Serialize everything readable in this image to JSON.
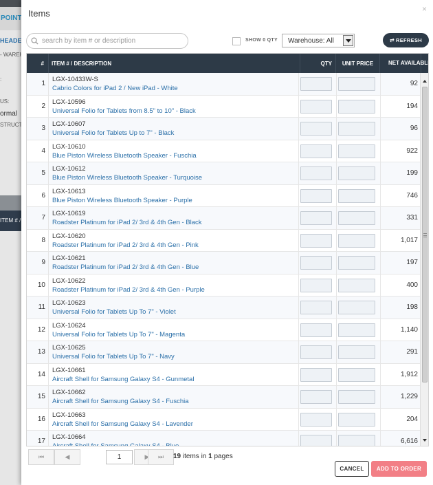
{
  "background": {
    "tab_label": "POINTS",
    "section_header": "HEADER",
    "warehouse_fragment": "- WAREH",
    "status_fragment": "US:",
    "normal_fragment": "ormal",
    "instructions_fragment": "STRUCTI",
    "item_header_fragment": "ITEM # /"
  },
  "modal": {
    "title": "Items",
    "close_label": "×",
    "search_placeholder": "search by item # or description",
    "search_value": "",
    "show_zero_label": "SHOW 0 QTY",
    "warehouse_label": "Warehouse: All",
    "refresh_label": "REFRESH",
    "cancel_label": "CANCEL",
    "add_label": "ADD TO ORDER"
  },
  "columns": {
    "num": "#",
    "item": "ITEM # / DESCRIPTION",
    "qty": "QTY",
    "price": "UNIT PRICE",
    "net": "NET AVAILABLE"
  },
  "rows": [
    {
      "n": "1",
      "sku": "LGX-10433W-S",
      "desc": "Cabrio Colors for iPad 2 / New iPad - White",
      "net": "92"
    },
    {
      "n": "2",
      "sku": "LGX-10596",
      "desc": "Universal Folio for Tablets from 8.5\" to 10\" - Black",
      "net": "194"
    },
    {
      "n": "3",
      "sku": "LGX-10607",
      "desc": "Universal Folio for Tablets Up to 7\" - Black",
      "net": "96"
    },
    {
      "n": "4",
      "sku": "LGX-10610",
      "desc": "Blue Piston Wireless Bluetooth Speaker - Fuschia",
      "net": "922"
    },
    {
      "n": "5",
      "sku": "LGX-10612",
      "desc": "Blue Piston Wireless Bluetooth Speaker - Turquoise",
      "net": "199"
    },
    {
      "n": "6",
      "sku": "LGX-10613",
      "desc": "Blue Piston Wireless Bluetooth Speaker - Purple",
      "net": "746"
    },
    {
      "n": "7",
      "sku": "LGX-10619",
      "desc": "Roadster Platinum for iPad 2/ 3rd & 4th Gen - Black",
      "net": "331"
    },
    {
      "n": "8",
      "sku": "LGX-10620",
      "desc": "Roadster Platinum for iPad 2/ 3rd & 4th Gen - Pink",
      "net": "1,017"
    },
    {
      "n": "9",
      "sku": "LGX-10621",
      "desc": "Roadster Platinum for iPad 2/ 3rd & 4th Gen - Blue",
      "net": "197"
    },
    {
      "n": "10",
      "sku": "LGX-10622",
      "desc": "Roadster Platinum for iPad 2/ 3rd & 4th Gen - Purple",
      "net": "400"
    },
    {
      "n": "11",
      "sku": "LGX-10623",
      "desc": "Universal Folio for Tablets Up To 7\" - Violet",
      "net": "198"
    },
    {
      "n": "12",
      "sku": "LGX-10624",
      "desc": "Universal Folio for Tablets Up To 7\" - Magenta",
      "net": "1,140"
    },
    {
      "n": "13",
      "sku": "LGX-10625",
      "desc": "Universal Folio for Tablets Up To 7\" - Navy",
      "net": "291"
    },
    {
      "n": "14",
      "sku": "LGX-10661",
      "desc": "Aircraft Shell for Samsung Galaxy S4 - Gunmetal",
      "net": "1,912"
    },
    {
      "n": "15",
      "sku": "LGX-10662",
      "desc": "Aircraft Shell for Samsung Galaxy S4 - Fuschia",
      "net": "1,229"
    },
    {
      "n": "16",
      "sku": "LGX-10663",
      "desc": "Aircraft Shell for Samsung Galaxy S4 - Lavender",
      "net": "204"
    },
    {
      "n": "17",
      "sku": "LGX-10664",
      "desc": "Aircraft Shell for Samsung Galaxy S4 - Blue",
      "net": "6,616"
    }
  ],
  "pager": {
    "first_icon": "first-page-icon",
    "prev_icon": "prev-page-icon",
    "next_icon": "next-page-icon",
    "last_icon": "last-page-icon",
    "current_page": "1",
    "total_items": "19",
    "items_in_text": "items in",
    "total_pages": "1",
    "pages_text": "pages"
  },
  "colors": {
    "header_bg": "#2d3a47",
    "link_blue": "#2a6fa8",
    "add_button": "#f27f86"
  }
}
